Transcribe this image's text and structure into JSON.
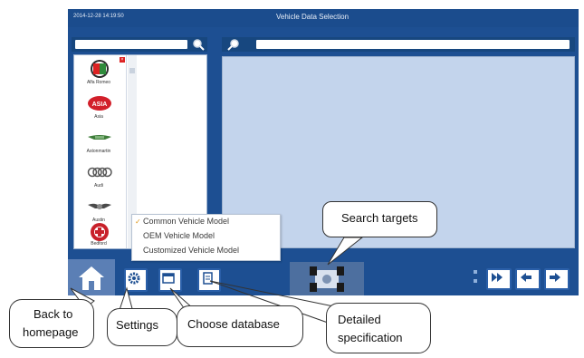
{
  "window": {
    "timestamp": "2014-12-28 14:19:50",
    "title": "Vehicle Data Selection"
  },
  "brands": [
    {
      "name": "Alfa Romeo",
      "icon": "alfa-romeo-logo"
    },
    {
      "name": "Asia",
      "icon": "asia-logo",
      "logo_text": "ASIA"
    },
    {
      "name": "Astonmartin",
      "icon": "aston-martin-logo"
    },
    {
      "name": "Audi",
      "icon": "audi-logo"
    },
    {
      "name": "Austin",
      "icon": "austin-logo"
    },
    {
      "name": "Bedford",
      "icon": "bedford-logo"
    }
  ],
  "dropdown": {
    "items": [
      "Common Vehicle Model",
      "OEM Vehicle Model",
      "Customized Vehicle Model"
    ],
    "selected": "Common Vehicle Model"
  },
  "callouts": {
    "search_targets": "Search targets",
    "back_to_homepage": [
      "Back to",
      "homepage"
    ],
    "settings": "Settings",
    "choose_database": "Choose database",
    "detailed_specification": [
      "Detailed",
      "specification"
    ]
  },
  "colors": {
    "window_blue": "#1d4f92",
    "content_blue": "#c3d4ec"
  }
}
